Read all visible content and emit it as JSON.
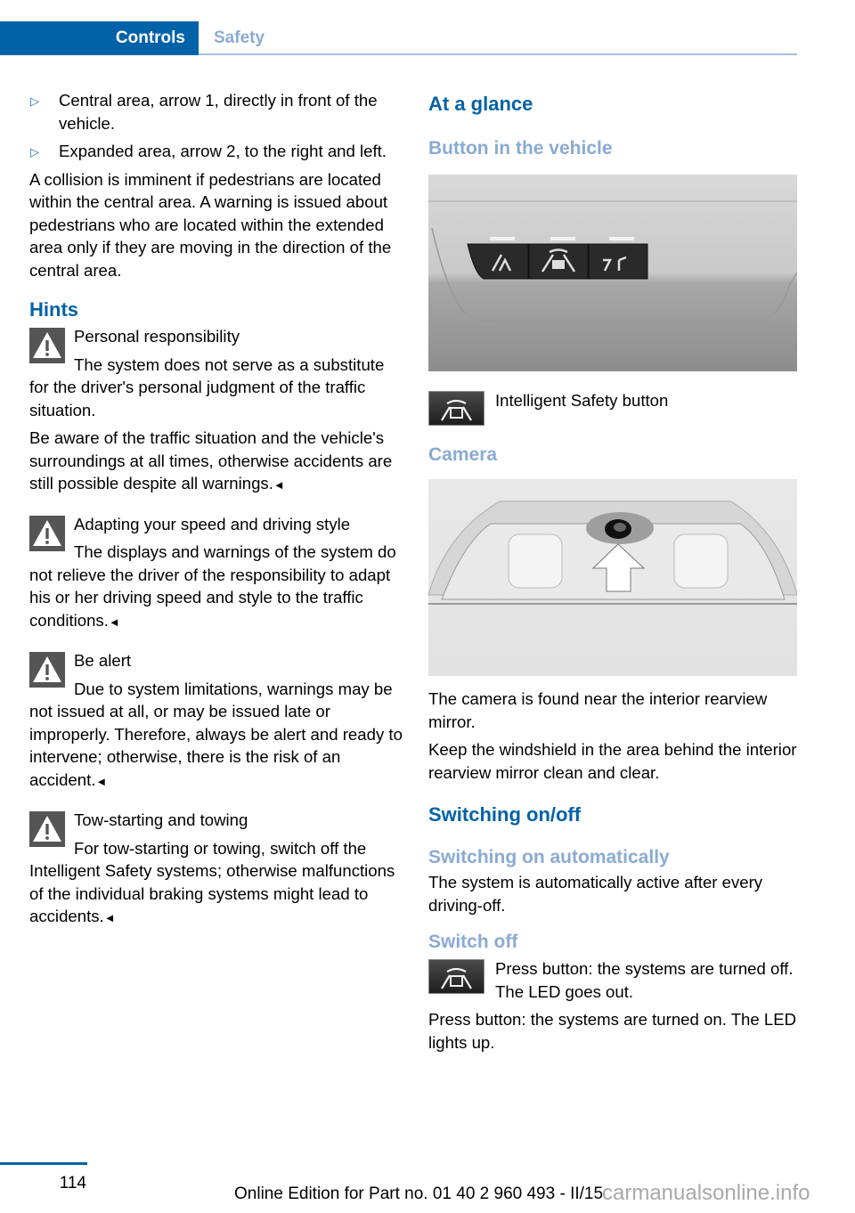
{
  "header": {
    "active_tab": "Controls",
    "inactive_tab": "Safety",
    "colors": {
      "accent": "#0062a7",
      "light_accent": "#8aaad4"
    }
  },
  "left": {
    "bullets": [
      "Central area, arrow 1, directly in front of the vehicle.",
      "Expanded area, arrow 2, to the right and left."
    ],
    "collision_text": "A collision is imminent if pedestrians are located within the central area. A warning is issued about pedestrians who are located within the extended area only if they are moving in the direction of the central area.",
    "hints_heading": "Hints",
    "warnings": [
      {
        "icon": "warning-triangle-icon",
        "title": "Personal responsibility",
        "body": "The system does not serve as a substitute for the driver's personal judgment of the traffic situation.",
        "extra": "Be aware of the traffic situation and the vehicle's surroundings at all times, otherwise accidents are still possible despite all warnings.",
        "end_mark": "◄"
      },
      {
        "icon": "warning-triangle-icon",
        "title": "Adapting your speed and driving style",
        "body": "The displays and warnings of the system do not relieve the driver of the responsibility to adapt his or her driving speed and style to the traffic conditions.",
        "end_mark": "◄"
      },
      {
        "icon": "warning-triangle-icon",
        "title": "Be alert",
        "body": "Due to system limitations, warnings may be not issued at all, or may be issued late or improperly. Therefore, always be alert and ready to intervene; otherwise, there is the risk of an accident.",
        "end_mark": "◄"
      },
      {
        "icon": "warning-triangle-icon",
        "title": "Tow-starting and towing",
        "body": "For tow-starting or towing, switch off the Intelligent Safety systems; otherwise malfunctions of the individual braking systems might lead to accidents.",
        "end_mark": "◄"
      }
    ]
  },
  "right": {
    "at_a_glance": "At a glance",
    "button_heading": "Button in the vehicle",
    "button_caption": "Intelligent Safety button",
    "camera_heading": "Camera",
    "camera_text_1": "The camera is found near the interior rearview mirror.",
    "camera_text_2": "Keep the windshield in the area behind the interior rearview mirror clean and clear.",
    "switching_heading": "Switching on/off",
    "auto_heading": "Switching on automatically",
    "auto_text": "The system is automatically active after every driving-off.",
    "switch_off_heading": "Switch off",
    "switch_off_text": "Press button: the systems are turned off. The LED goes out.",
    "switch_on_text": "Press button: the systems are turned on. The LED lights up."
  },
  "footer": {
    "page_number": "114",
    "edition": "Online Edition for Part no. 01 40 2 960 493 - II/15",
    "watermark": "carmanualsonline.info"
  }
}
